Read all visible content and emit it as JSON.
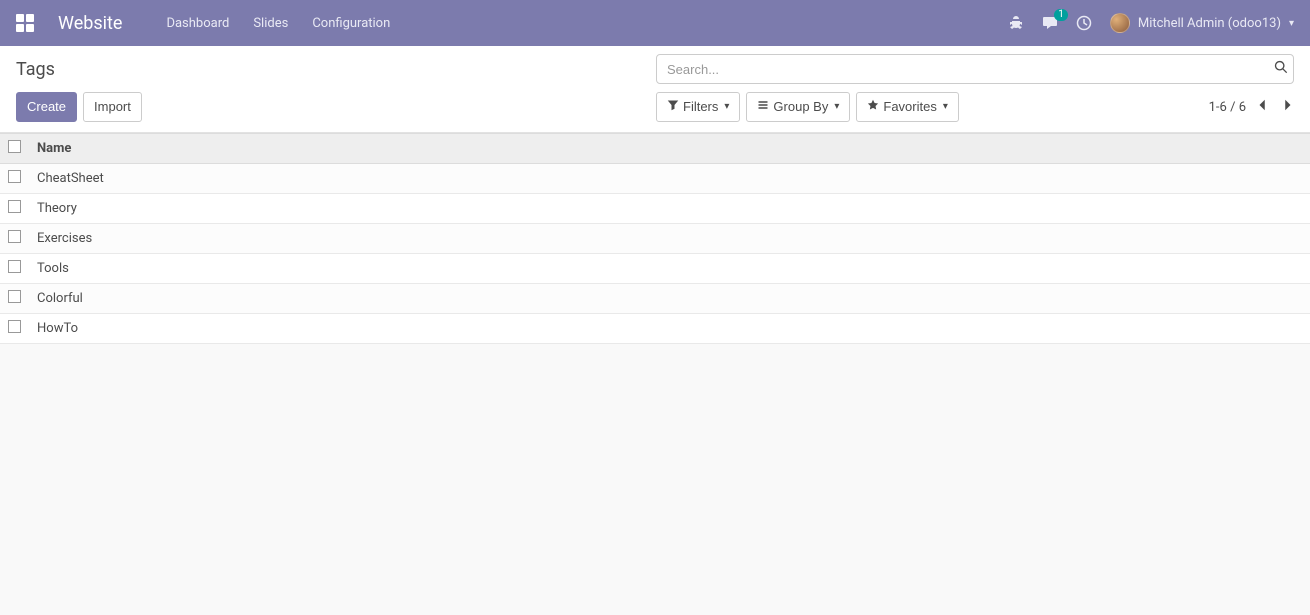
{
  "navbar": {
    "brand": "Website",
    "menu": [
      "Dashboard",
      "Slides",
      "Configuration"
    ],
    "message_count": "1",
    "user_name": "Mitchell Admin (odoo13)"
  },
  "breadcrumb": "Tags",
  "search": {
    "placeholder": "Search..."
  },
  "buttons": {
    "create": "Create",
    "import": "Import",
    "filters": "Filters",
    "group_by": "Group By",
    "favorites": "Favorites"
  },
  "pager": {
    "range": "1-6",
    "sep": "/",
    "total": "6"
  },
  "table": {
    "columns": [
      "Name"
    ],
    "rows": [
      {
        "name": "CheatSheet"
      },
      {
        "name": "Theory"
      },
      {
        "name": "Exercises"
      },
      {
        "name": "Tools"
      },
      {
        "name": "Colorful"
      },
      {
        "name": "HowTo"
      }
    ]
  }
}
